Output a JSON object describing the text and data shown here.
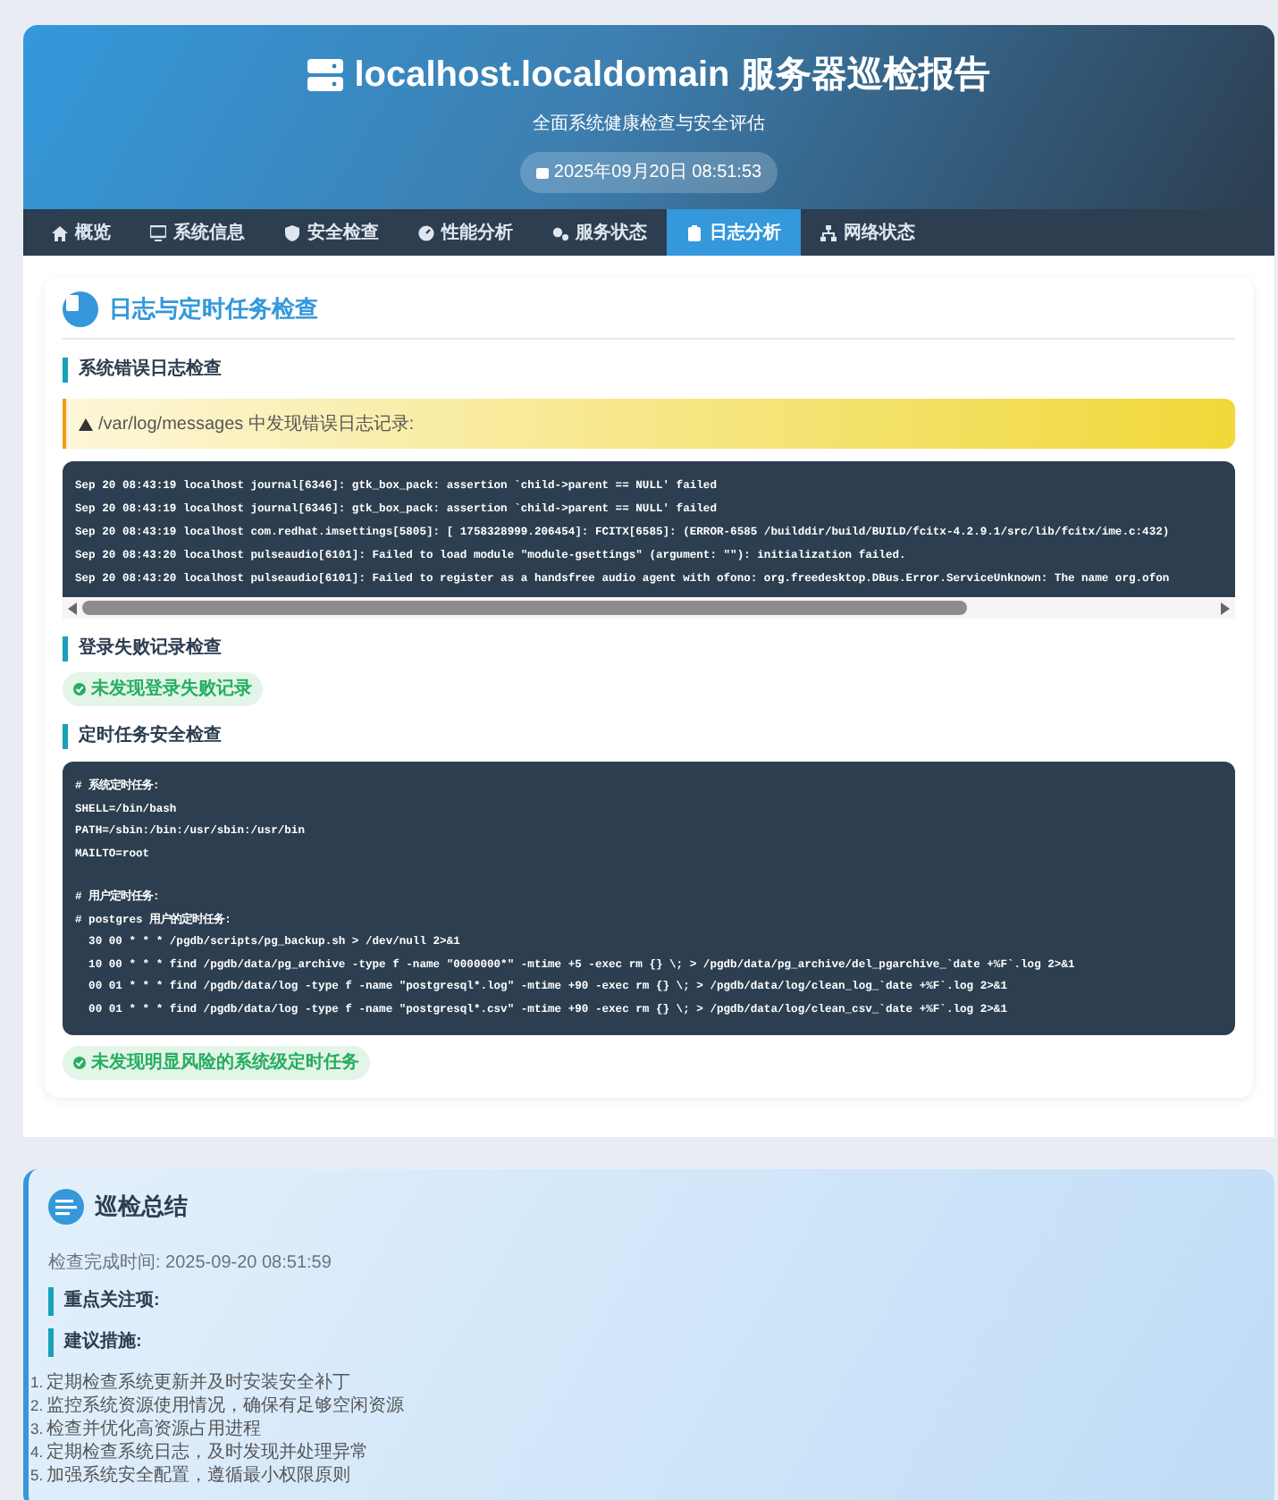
{
  "header": {
    "title": "localhost.localdomain 服务器巡检报告",
    "subtitle": "全面系统健康检查与安全评估",
    "date": "2025年09月20日 08:51:53"
  },
  "tabs": [
    {
      "label": "概览",
      "selected": false
    },
    {
      "label": "系统信息",
      "selected": false
    },
    {
      "label": "安全检查",
      "selected": false
    },
    {
      "label": "性能分析",
      "selected": false
    },
    {
      "label": "服务状态",
      "selected": false
    },
    {
      "label": "日志分析",
      "selected": true
    },
    {
      "label": "网络状态",
      "selected": false
    }
  ],
  "section": {
    "title": "日志与定时任务检查",
    "blocks": [
      {
        "kind": "heading",
        "text": "系统错误日志检查"
      },
      {
        "kind": "warning",
        "text": "/var/log/messages 中发现错误日志记录:"
      },
      {
        "kind": "log",
        "lines": [
          "Sep 20 08:43:19 localhost journal[6346]: gtk_box_pack: assertion `child->parent == NULL' failed",
          "Sep 20 08:43:19 localhost journal[6346]: gtk_box_pack: assertion `child->parent == NULL' failed",
          "Sep 20 08:43:19 localhost com.redhat.imsettings[5805]: [ 1758328999.206454]: FCITX[6585]: (ERROR-6585 /builddir/build/BUILD/fcitx-4.2.9.1/src/lib/fcitx/ime.c:432)",
          "Sep 20 08:43:20 localhost pulseaudio[6101]: Failed to load module \"module-gsettings\" (argument: \"\"): initialization failed.",
          "Sep 20 08:43:20 localhost pulseaudio[6101]: Failed to register as a handsfree audio agent with ofono: org.freedesktop.DBus.Error.ServiceUnknown: The name org.ofon"
        ]
      },
      {
        "kind": "heading",
        "text": "登录失败记录检查"
      },
      {
        "kind": "success",
        "text": "未发现登录失败记录"
      },
      {
        "kind": "heading",
        "text": "定时任务安全检查"
      },
      {
        "kind": "code",
        "groups": [
          [
            "# 系统定时任务:",
            "SHELL=/bin/bash",
            "PATH=/sbin:/bin:/usr/sbin:/usr/bin",
            "MAILTO=root"
          ],
          [
            "# 用户定时任务:",
            "# postgres 用户的定时任务:",
            "  30 00 * * * /pgdb/scripts/pg_backup.sh > /dev/null 2>&1",
            "  10 00 * * * find /pgdb/data/pg_archive -type f -name \"0000000*\" -mtime +5 -exec rm {} \\; > /pgdb/data/pg_archive/del_pgarchive_`date +%F`.log 2>&1",
            "  00 01 * * * find /pgdb/data/log -type f -name \"postgresql*.log\" -mtime +90 -exec rm {} \\; > /pgdb/data/log/clean_log_`date +%F`.log 2>&1",
            "  00 01 * * * find /pgdb/data/log -type f -name \"postgresql*.csv\" -mtime +90 -exec rm {} \\; > /pgdb/data/log/clean_csv_`date +%F`.log 2>&1"
          ]
        ]
      },
      {
        "kind": "success",
        "text": "未发现明显风险的系统级定时任务"
      }
    ]
  },
  "summary": {
    "title": "巡检总结",
    "completed": "检查完成时间: 2025-09-20 08:51:59",
    "headings": [
      "重点关注项:",
      "建议措施:"
    ],
    "recommendations": [
      {
        "number": "1.",
        "text": "定期检查系统更新并及时安装安全补丁"
      },
      {
        "number": "2.",
        "text": "监控系统资源使用情况，确保有足够空闲资源"
      },
      {
        "number": "3.",
        "text": "检查并优化高资源占用进程"
      },
      {
        "number": "4.",
        "text": "定期检查系统日志，及时发现并处理异常"
      },
      {
        "number": "5.",
        "text": "加强系统安全配置，遵循最小权限原则"
      }
    ]
  }
}
